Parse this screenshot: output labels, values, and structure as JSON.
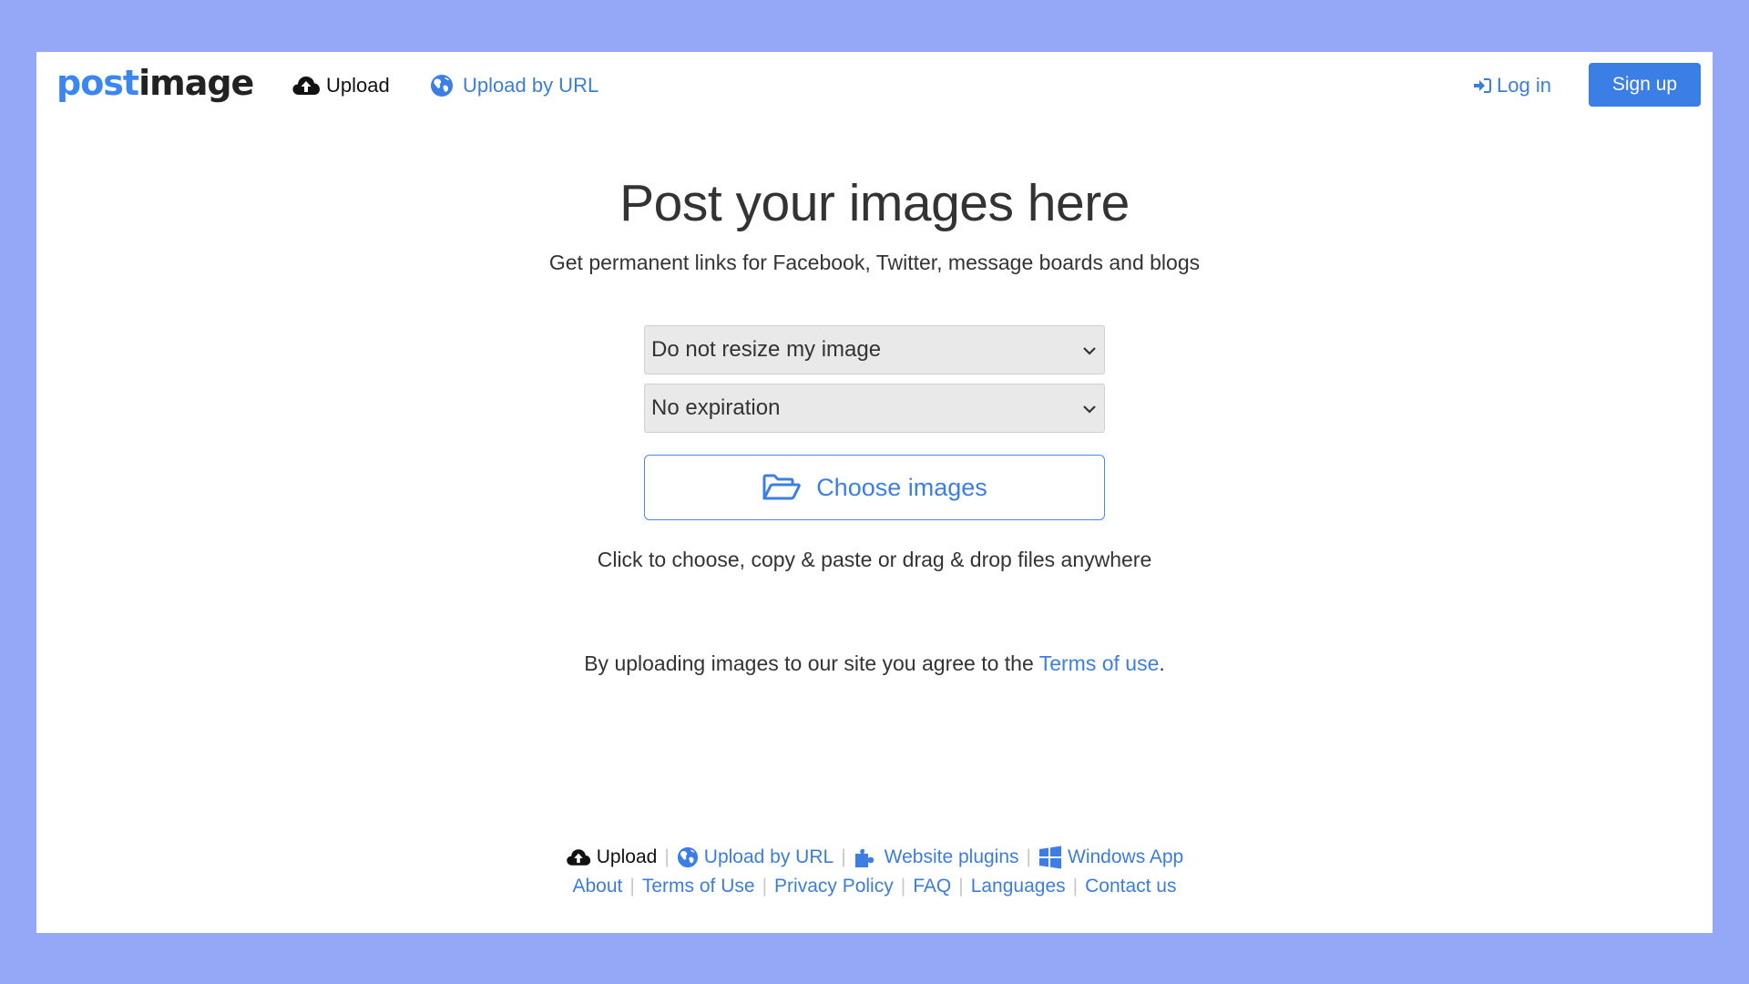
{
  "colors": {
    "background": "#95a8f8",
    "accent": "#3b7fe6",
    "link": "#3b7ddd",
    "text": "#333333"
  },
  "header": {
    "logo": {
      "part1": "post",
      "part2": "image"
    },
    "nav": [
      {
        "label": "Upload",
        "icon": "cloud-upload-icon"
      },
      {
        "label": "Upload by URL",
        "icon": "globe-icon"
      }
    ],
    "login": {
      "label": "Log in",
      "icon": "sign-in-icon"
    },
    "signup": {
      "label": "Sign up"
    }
  },
  "main": {
    "title": "Post your images here",
    "subtitle": "Get permanent links for Facebook, Twitter, message boards and blogs",
    "resize_select": {
      "selected": "Do not resize my image"
    },
    "expiration_select": {
      "selected": "No expiration"
    },
    "choose_button": {
      "label": "Choose images",
      "icon": "folder-open-icon"
    },
    "hint": "Click to choose, copy & paste or drag & drop files anywhere",
    "terms": {
      "prefix": "By uploading images to our site you agree to the ",
      "link": "Terms of use",
      "suffix": "."
    }
  },
  "footer": {
    "row1": [
      {
        "label": "Upload",
        "icon": "cloud-upload-icon"
      },
      {
        "label": "Upload by URL",
        "icon": "globe-icon"
      },
      {
        "label": "Website plugins",
        "icon": "puzzle-icon"
      },
      {
        "label": "Windows App",
        "icon": "windows-icon"
      }
    ],
    "row2": [
      {
        "label": "About"
      },
      {
        "label": "Terms of Use"
      },
      {
        "label": "Privacy Policy"
      },
      {
        "label": "FAQ"
      },
      {
        "label": "Languages"
      },
      {
        "label": "Contact us"
      }
    ],
    "separator": "|"
  }
}
